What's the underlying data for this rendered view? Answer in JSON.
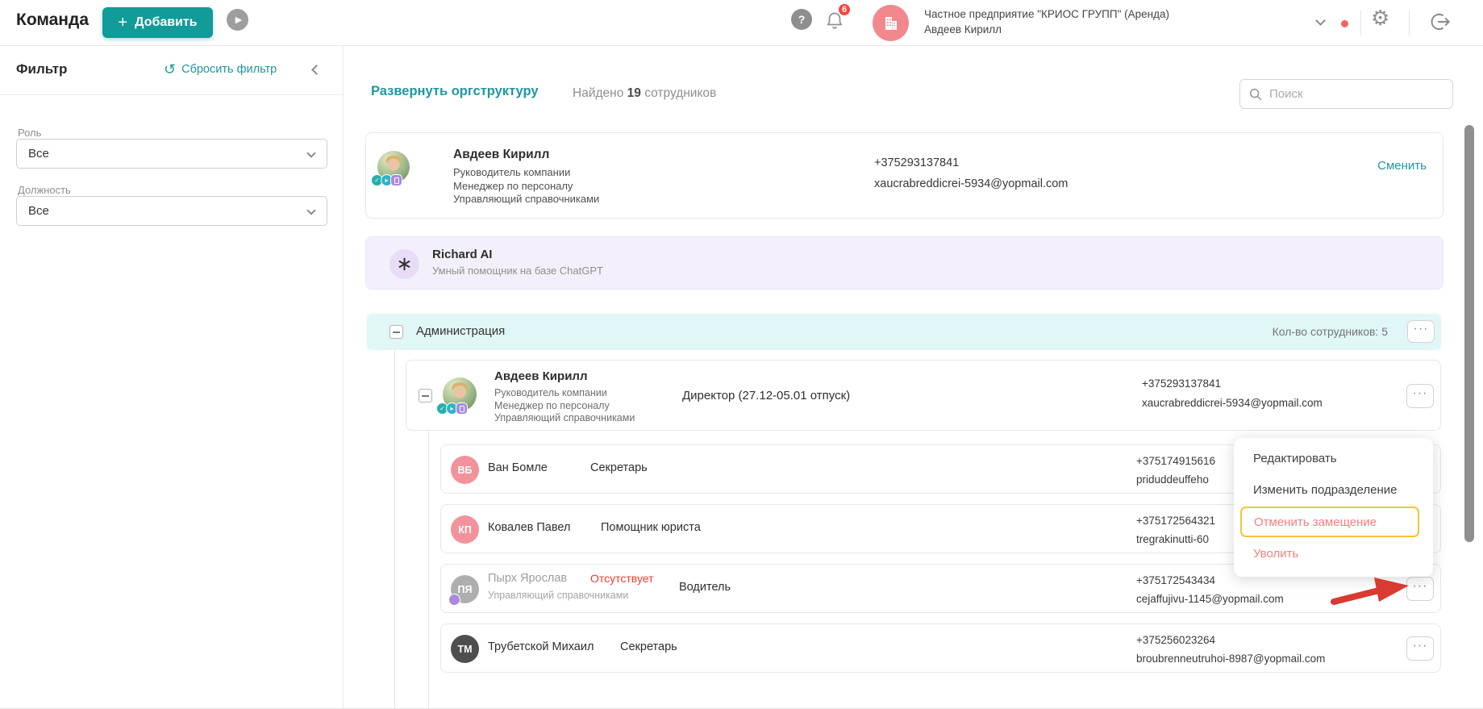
{
  "colors": {
    "accent": "#119b99",
    "link": "#1f97a1",
    "danger": "#f23b2f",
    "menu_danger": "#f28080",
    "highlight": "#f4c23c",
    "badge_red": "#f4453e",
    "dept_bg": "#e1f6f6",
    "assistant_bg": "#f4f0fb",
    "avatar_pink": "#f2939b",
    "avatar_gray": "#aeaeae",
    "avatar_dark": "#4e4e4e",
    "company_avatar": "#f2888d",
    "assistant_avatar": "#e7ddf6",
    "badge_teal": "#23b0ab",
    "badge_cyan": "#2fb3c9",
    "badge_purple": "#a88ae0",
    "arrow": "#d93a32",
    "scrollbar": "#8f8f8f"
  },
  "icons": {
    "plus": "+",
    "play": "▶",
    "help": "?",
    "reset": "↺",
    "gear": "⚙",
    "ellipsis": "···",
    "check": "✓",
    "tri": "▸"
  },
  "header": {
    "title": "Команда",
    "add_button": "Добавить",
    "notifications_count": "6",
    "company_name": "Частное предприятие \"КРИОС ГРУПП\" (Аренда)",
    "user_name": "Авдеев Кирилл"
  },
  "sidebar": {
    "title": "Фильтр",
    "reset_label": "Сбросить фильтр",
    "filters": [
      {
        "label": "Роль",
        "value": "Все"
      },
      {
        "label": "Должность",
        "value": "Все"
      }
    ]
  },
  "toolbar": {
    "expand_link": "Развернуть оргструктуру",
    "found_prefix": "Найдено",
    "found_count": "19",
    "found_suffix": "сотрудников",
    "search_placeholder": "Поиск"
  },
  "owner_card": {
    "name": "Авдеев Кирилл",
    "roles": [
      "Руководитель компании",
      "Менеджер по персоналу",
      "Управляющий справочниками"
    ],
    "phone": "+375293137841",
    "email": "xaucrabreddicrei-5934@yopmail.com",
    "change_label": "Сменить"
  },
  "assistant_card": {
    "name": "Richard AI",
    "subtitle": "Умный помощник на базе ChatGPT"
  },
  "department": {
    "name": "Администрация",
    "count_label": "Кол-во сотрудников: 5"
  },
  "director": {
    "name": "Авдеев Кирилл",
    "roles": [
      "Руководитель компании",
      "Менеджер по персоналу",
      "Управляющий справочниками"
    ],
    "position": "Директор (27.12-05.01 отпуск)",
    "phone": "+375293137841",
    "email": "xaucrabreddicrei-5934@yopmail.com"
  },
  "employees": [
    {
      "initials": "ВБ",
      "name": "Ван Бомле",
      "position": "Секретарь",
      "phone": "+375174915616",
      "email": "priduddeuffeho"
    },
    {
      "initials": "КП",
      "name": "Ковалев Павел",
      "position": "Помощник юриста",
      "phone": "+375172564321",
      "email": "tregrakinutti-60"
    },
    {
      "initials": "ПЯ",
      "name": "Пырх Ярослав",
      "status": "Отсутствует",
      "subtitle": "Управляющий справочниками",
      "position": "Водитель",
      "phone": "+375172543434",
      "email": "cejaffujivu-1145@yopmail.com"
    },
    {
      "initials": "ТМ",
      "name": "Трубетской Михаил",
      "position": "Секретарь",
      "phone": "+375256023264",
      "email": "broubrenneutruhoi-8987@yopmail.com"
    }
  ],
  "context_menu": {
    "items": [
      "Редактировать",
      "Изменить подразделение",
      "Отменить замещение",
      "Уволить"
    ]
  }
}
